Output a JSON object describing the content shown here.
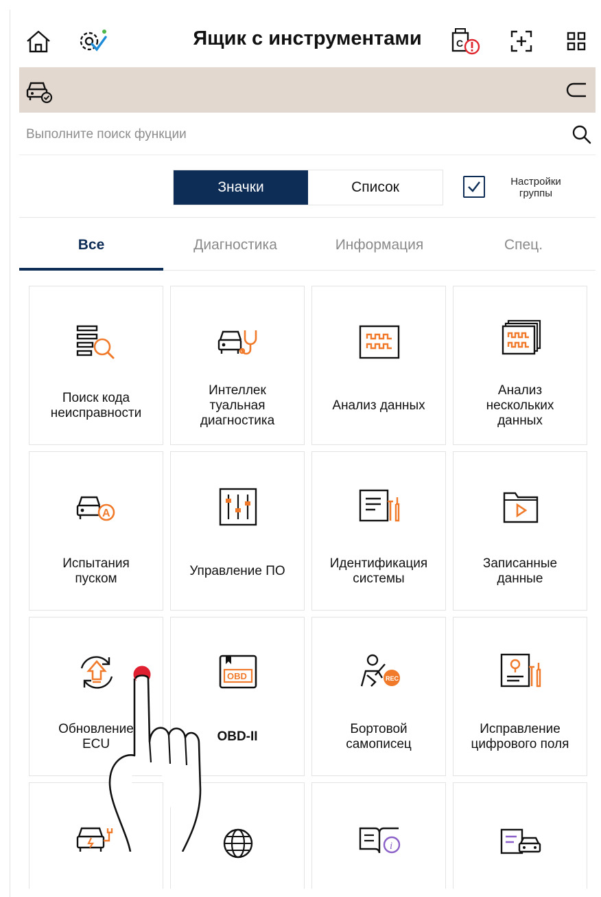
{
  "header": {
    "title": "Ящик с инструментами",
    "icons": [
      "home-icon",
      "settings-check-icon",
      "vci-alert-icon",
      "screenshot-icon",
      "grid-menu-icon"
    ]
  },
  "vehicle_bar": {
    "icons": [
      "vehicle-check-icon",
      "back-arrow-icon"
    ]
  },
  "search": {
    "placeholder": "Выполните поиск функции",
    "value": ""
  },
  "view_toggle": {
    "options": [
      "Значки",
      "Список"
    ],
    "selected": "Значки"
  },
  "group_settings": {
    "label": "Настройки\nгруппы",
    "checked": true
  },
  "tabs": [
    {
      "label": "Все",
      "active": true
    },
    {
      "label": "Диагностика",
      "active": false
    },
    {
      "label": "Информация",
      "active": false
    },
    {
      "label": "Спец.",
      "active": false
    }
  ],
  "tiles": [
    {
      "label": "Поиск кода\nнеисправности",
      "icon": "dtc-search-icon"
    },
    {
      "label": "Интеллек\nтуальная\nдиагностика",
      "icon": "smart-diagnosis-icon"
    },
    {
      "label": "Анализ данных",
      "icon": "data-analysis-icon"
    },
    {
      "label": "Анализ\nнескольких\nданных",
      "icon": "multi-data-analysis-icon"
    },
    {
      "label": "Испытания\nпуском",
      "icon": "actuation-test-icon"
    },
    {
      "label": "Управление ПО",
      "icon": "software-management-icon"
    },
    {
      "label": "Идентификация\nсистемы",
      "icon": "system-identification-icon"
    },
    {
      "label": "Записанные\nданные",
      "icon": "recorded-data-icon"
    },
    {
      "label": "Обновление\nECU",
      "icon": "ecu-update-icon"
    },
    {
      "label": "OBD-II",
      "icon": "obd-icon"
    },
    {
      "label": "Бортовой\nсамописец",
      "icon": "onboard-recorder-icon"
    },
    {
      "label": "Исправление\nцифрового поля",
      "icon": "digital-field-fix-icon"
    },
    {
      "label": "",
      "icon": "ev-car-icon"
    },
    {
      "label": "",
      "icon": "globe-icon"
    },
    {
      "label": "",
      "icon": "info-book-icon"
    },
    {
      "label": "",
      "icon": "vehicle-document-icon"
    }
  ],
  "colors": {
    "navy": "#0d2d57",
    "orange": "#f07a2a",
    "vehicle_bar": "#e2d8cf",
    "touch_dot": "#e02030"
  }
}
